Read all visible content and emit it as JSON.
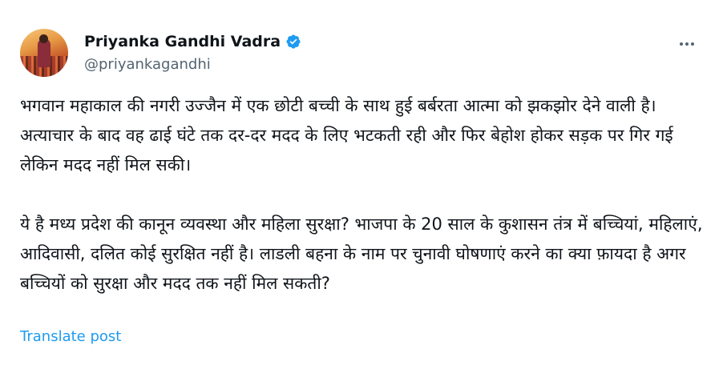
{
  "author": {
    "display_name": "Priyanka Gandhi Vadra",
    "handle": "@priyankagandhi",
    "verified_icon": "verified-badge-icon"
  },
  "post": {
    "paragraph_1": "भगवान महाकाल की नगरी उज्जैन में एक छोटी बच्ची के साथ हुई बर्बरता आत्मा को झकझोर देने वाली है। अत्याचार के बाद वह ढाई घंटे तक दर-दर मदद के लिए भटकती रही और फिर बेहोश होकर सड़क पर गिर गई लेकिन मदद नहीं मिल सकी।",
    "paragraph_2": "ये है मध्य प्रदेश की कानून व्यवस्था और महिला सुरक्षा? भाजपा के 20 साल के कुशासन तंत्र में बच्चियां, महिलाएं, आदिवासी, दलित कोई सुरक्षित नहीं है। लाडली बहना के नाम पर चुनावी घोषणाएं करने का क्या फ़ायदा है अगर बच्चियों को सुरक्षा और मदद तक नहीं मिल सकती?",
    "translate_label": "Translate post"
  },
  "colors": {
    "accent": "#1d9bf0",
    "text": "#0f1419",
    "secondary": "#536471"
  }
}
